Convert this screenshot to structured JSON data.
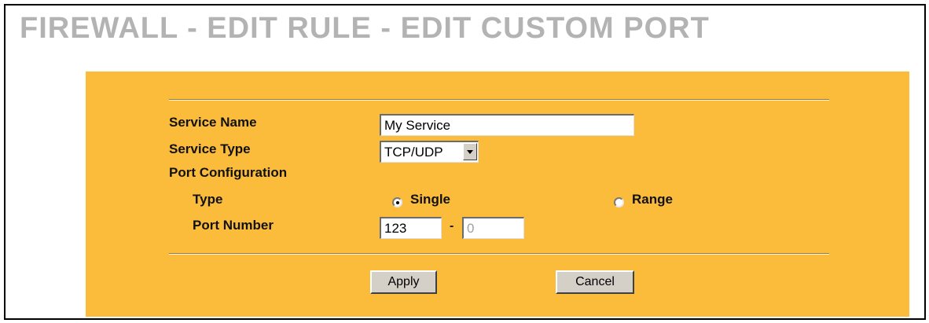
{
  "page": {
    "title": "FIREWALL - EDIT RULE - EDIT CUSTOM PORT"
  },
  "form": {
    "service_name_label": "Service Name",
    "service_name_value": "My Service",
    "service_type_label": "Service Type",
    "service_type_value": "TCP/UDP",
    "port_configuration_label": "Port Configuration",
    "type_label": "Type",
    "type_options": [
      {
        "label": "Single",
        "selected": true
      },
      {
        "label": "Range",
        "selected": false
      }
    ],
    "port_number_label": "Port Number",
    "port_start_value": "123",
    "port_range_separator": "-",
    "port_end_value": "0",
    "port_end_disabled": true
  },
  "buttons": {
    "apply": "Apply",
    "cancel": "Cancel"
  },
  "colors": {
    "panel_background": "#fbbc3b",
    "title_color": "#b3b3b3",
    "button_face": "#d4d0c8"
  }
}
